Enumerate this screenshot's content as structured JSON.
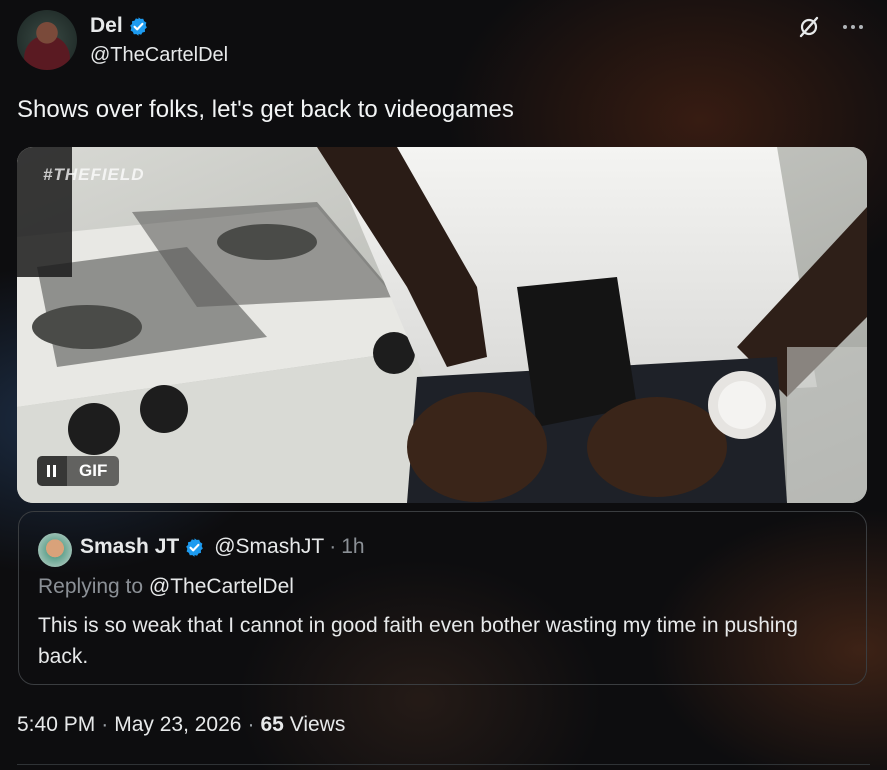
{
  "author": {
    "name": "Del",
    "handle": "@TheCartelDel"
  },
  "tweet": {
    "text": "Shows over folks, let's get back to videogames"
  },
  "media": {
    "watermark": "#THEFIELD",
    "gif_label": "GIF"
  },
  "quoted": {
    "name": "Smash JT",
    "handle": "@SmashJT",
    "time": "1h",
    "reply_prefix": "Replying to",
    "reply_user": "@TheCartelDel",
    "text": "This is so weak that I cannot in good faith even bother wasting my time in pushing back."
  },
  "meta": {
    "time": "5:40 PM",
    "date": "May 23, 2026",
    "views_count": "65",
    "views_label": "Views"
  },
  "colors": {
    "verified": "#1d9bf0",
    "muted": "#8b9096",
    "border": "#3a3d40"
  }
}
